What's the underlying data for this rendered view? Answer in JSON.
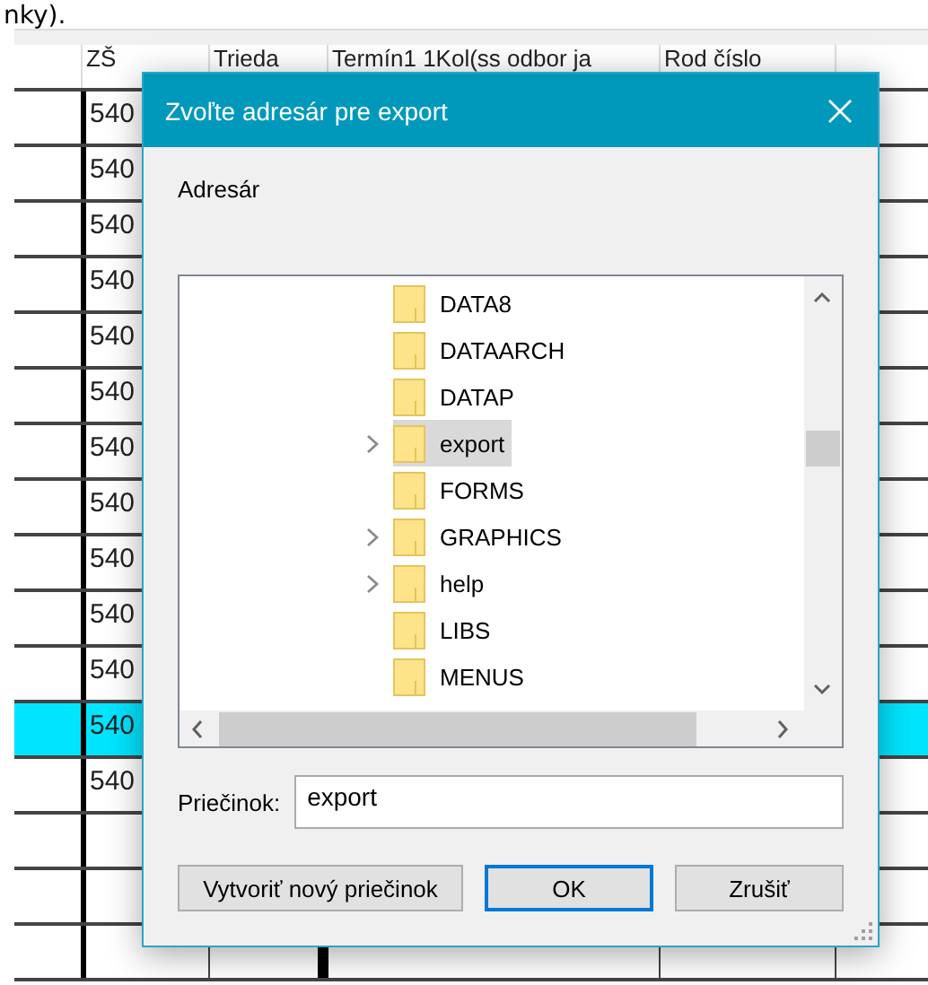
{
  "background_text": "nky).",
  "sheet": {
    "columns": [
      {
        "label": "ZŠ"
      },
      {
        "label": "Trieda"
      },
      {
        "label": "Termín1 1Kol(ss odbor ja"
      },
      {
        "label": "Rod číslo"
      }
    ],
    "rows": [
      {
        "cell": "540",
        "selected": false
      },
      {
        "cell": "540",
        "selected": false
      },
      {
        "cell": "540",
        "selected": false
      },
      {
        "cell": "540",
        "selected": false
      },
      {
        "cell": "540",
        "selected": false
      },
      {
        "cell": "540",
        "selected": false
      },
      {
        "cell": "540",
        "selected": false
      },
      {
        "cell": "540",
        "selected": false
      },
      {
        "cell": "540",
        "selected": false
      },
      {
        "cell": "540",
        "selected": false
      },
      {
        "cell": "540",
        "selected": false
      },
      {
        "cell": "540",
        "selected": true
      },
      {
        "cell": "540",
        "selected": false
      }
    ]
  },
  "dialog": {
    "title": "Zvoľte adresár pre export",
    "label": "Adresár",
    "tree": [
      {
        "label": "DATA8",
        "expandable": false,
        "selected": false
      },
      {
        "label": "DATAARCH",
        "expandable": false,
        "selected": false
      },
      {
        "label": "DATAP",
        "expandable": false,
        "selected": false
      },
      {
        "label": "export",
        "expandable": true,
        "selected": true
      },
      {
        "label": "FORMS",
        "expandable": false,
        "selected": false
      },
      {
        "label": "GRAPHICS",
        "expandable": true,
        "selected": false
      },
      {
        "label": "help",
        "expandable": true,
        "selected": false
      },
      {
        "label": "LIBS",
        "expandable": false,
        "selected": false
      },
      {
        "label": "MENUS",
        "expandable": false,
        "selected": false
      }
    ],
    "folder_label": "Priečinok:",
    "folder_value": "export",
    "buttons": [
      {
        "label": "Vytvoriť nový priečinok",
        "default": false
      },
      {
        "label": "OK",
        "default": true
      },
      {
        "label": "Zrušiť",
        "default": false
      }
    ]
  }
}
